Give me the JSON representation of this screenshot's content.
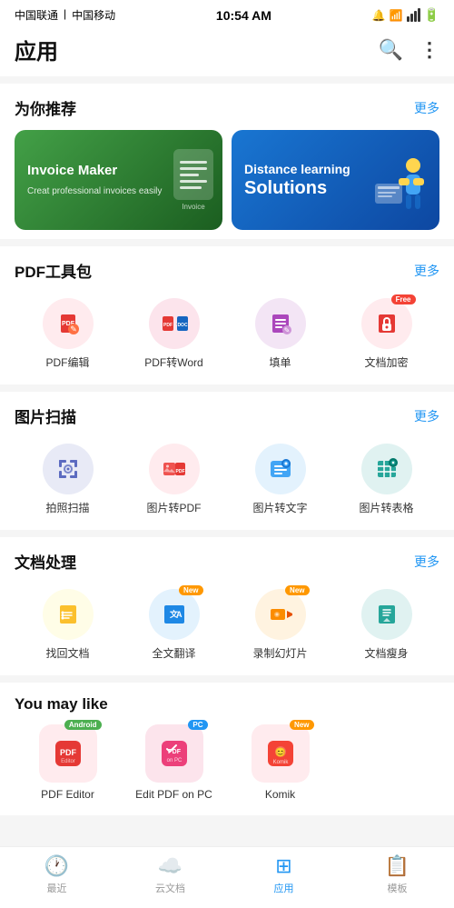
{
  "statusBar": {
    "left1": "中国联通",
    "left2": "中国移动",
    "time": "10:54 AM",
    "rightIcons": "🔔 📶 📶"
  },
  "header": {
    "title": "应用",
    "searchLabel": "搜索",
    "moreLabel": "更多"
  },
  "sections": {
    "recommend": {
      "title": "为你推荐",
      "more": "更多",
      "banners": [
        {
          "id": "invoice",
          "title": "Invoice Maker",
          "subtitle": "Creat professional\ninvoices easily",
          "bg": "green"
        },
        {
          "id": "distance",
          "line1": "Distance learning",
          "line2": "Solutions",
          "bg": "blue"
        }
      ]
    },
    "pdf": {
      "title": "PDF工具包",
      "more": "更多",
      "tools": [
        {
          "id": "pdf-edit",
          "label": "PDF编辑",
          "badge": null
        },
        {
          "id": "pdf-word",
          "label": "PDF转Word",
          "badge": null
        },
        {
          "id": "fill-form",
          "label": "填单",
          "badge": null
        },
        {
          "id": "doc-encrypt",
          "label": "文档加密",
          "badge": "Free"
        }
      ]
    },
    "scan": {
      "title": "图片扫描",
      "more": "更多",
      "tools": [
        {
          "id": "photo-scan",
          "label": "拍照扫描",
          "badge": null
        },
        {
          "id": "img-pdf",
          "label": "图片转PDF",
          "badge": null
        },
        {
          "id": "img-text",
          "label": "图片转文字",
          "badge": null
        },
        {
          "id": "img-table",
          "label": "图片转表格",
          "badge": null
        }
      ]
    },
    "docs": {
      "title": "文档处理",
      "more": "更多",
      "tools": [
        {
          "id": "recover-doc",
          "label": "找回文档",
          "badge": null
        },
        {
          "id": "translate",
          "label": "全文翻译",
          "badge": "New"
        },
        {
          "id": "record-ppt",
          "label": "录制幻灯片",
          "badge": "New"
        },
        {
          "id": "compress-doc",
          "label": "文档瘦身",
          "badge": null
        }
      ]
    },
    "youMayLike": {
      "title": "You may like",
      "items": [
        {
          "id": "pdf-editor",
          "label": "PDF Editor",
          "badge": "Android"
        },
        {
          "id": "edit-pdf-pc",
          "label": "Edit PDF on PC",
          "badge": "PC"
        },
        {
          "id": "komik",
          "label": "Komik",
          "badge": "New"
        }
      ]
    }
  },
  "bottomNav": {
    "items": [
      {
        "id": "recent",
        "label": "最近",
        "active": false
      },
      {
        "id": "cloud",
        "label": "云文档",
        "active": false
      },
      {
        "id": "apps",
        "label": "应用",
        "active": true
      },
      {
        "id": "templates",
        "label": "模板",
        "active": false
      }
    ]
  }
}
